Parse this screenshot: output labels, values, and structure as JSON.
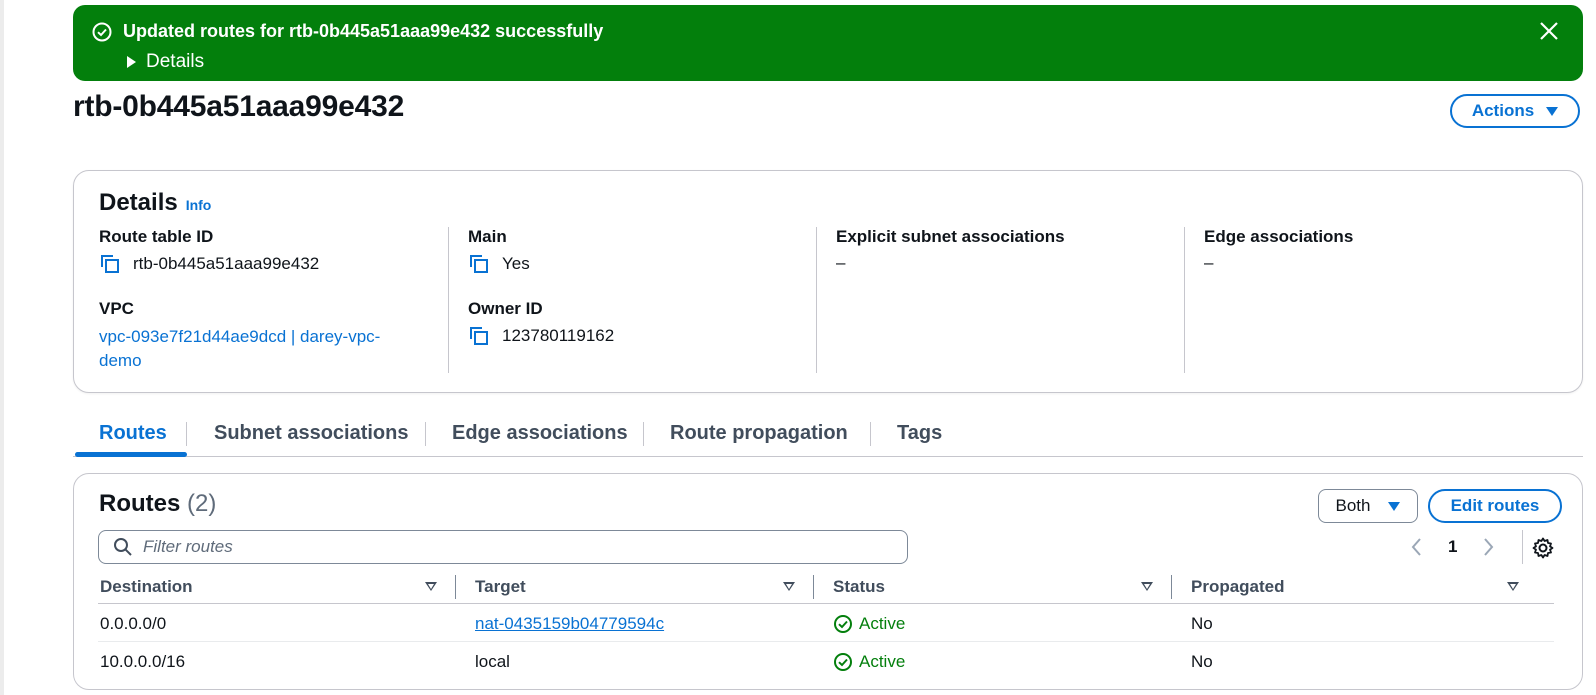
{
  "flash": {
    "message": "Updated routes for rtb-0b445a51aaa99e432 successfully",
    "details_label": "Details",
    "color": "#037f0c"
  },
  "page": {
    "title": "rtb-0b445a51aaa99e432",
    "actions_label": "Actions"
  },
  "details": {
    "heading": "Details",
    "info_label": "Info",
    "route_table_id_label": "Route table ID",
    "route_table_id": "rtb-0b445a51aaa99e432",
    "vpc_label": "VPC",
    "vpc_value_line1": "vpc-093e7f21d44ae9dcd | darey-vpc-",
    "vpc_value_line2": "demo",
    "main_label": "Main",
    "main_value": "Yes",
    "owner_label": "Owner ID",
    "owner_value": "123780119162",
    "explicit_label": "Explicit subnet associations",
    "explicit_value": "–",
    "edge_label": "Edge associations",
    "edge_value": "–"
  },
  "tabs": [
    {
      "label": "Routes",
      "active": true
    },
    {
      "label": "Subnet associations",
      "active": false
    },
    {
      "label": "Edge associations",
      "active": false
    },
    {
      "label": "Route propagation",
      "active": false
    },
    {
      "label": "Tags",
      "active": false
    }
  ],
  "routes": {
    "heading": "Routes",
    "count": "(2)",
    "filter_select": "Both",
    "edit_label": "Edit routes",
    "filter_placeholder": "Filter routes",
    "page_number": "1",
    "columns": [
      "Destination",
      "Target",
      "Status",
      "Propagated"
    ],
    "rows": [
      {
        "destination": "0.0.0.0/0",
        "target": "nat-0435159b04779594c",
        "target_is_link": true,
        "status": "Active",
        "propagated": "No"
      },
      {
        "destination": "10.0.0.0/16",
        "target": "local",
        "target_is_link": false,
        "status": "Active",
        "propagated": "No"
      }
    ]
  },
  "colors": {
    "accent": "#0972d3",
    "success": "#037f0c"
  },
  "icons": [
    "check-circle-icon",
    "close-icon",
    "caret-right-icon",
    "caret-down-icon",
    "copy-icon",
    "search-icon",
    "chevron-left-icon",
    "chevron-right-icon",
    "gear-icon",
    "sort-icon"
  ]
}
